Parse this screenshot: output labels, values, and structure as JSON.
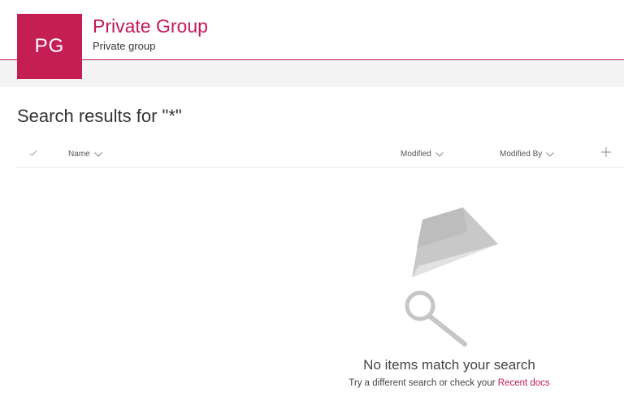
{
  "site": {
    "logo_initials": "PG",
    "title": "Private Group",
    "subtitle": "Private group",
    "accent": "#c2185b"
  },
  "search": {
    "heading": "Search results for \"*\""
  },
  "columns": {
    "check_icon": "checkmark-icon",
    "name": "Name",
    "modified": "Modified",
    "modified_by": "Modified By",
    "add_icon": "plus-icon"
  },
  "empty_state": {
    "title": "No items match your search",
    "hint_prefix": "Try a different search or check your ",
    "link": "Recent docs",
    "illustration": "paper-plane-magnifier-illustration"
  }
}
